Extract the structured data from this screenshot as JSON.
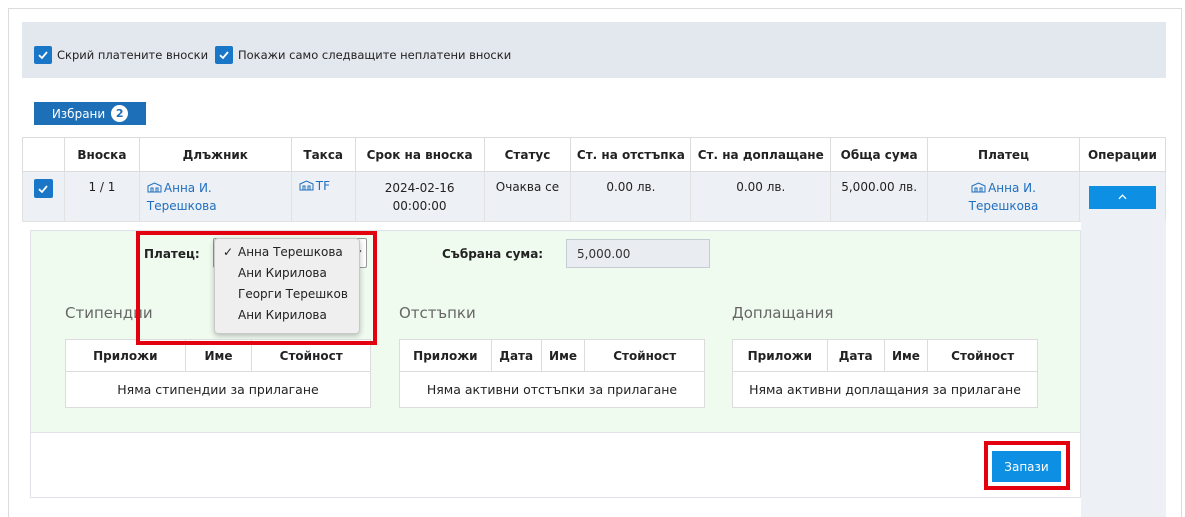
{
  "filters": {
    "hide_paid": "Скрий платените вноски",
    "show_next_unpaid": "Покажи само следващите неплатени вноски"
  },
  "selected_tab": {
    "label": "Избрани",
    "count": "2"
  },
  "table": {
    "headers": [
      "Вноска",
      "Длъжник",
      "Такса",
      "Срок на вноска",
      "Статус",
      "Ст. на отстъпка",
      "Ст. на доплащане",
      "Обща сума",
      "Платец",
      "Операции"
    ],
    "row": {
      "installment": "1 / 1",
      "debtor_line1": "Анна И.",
      "debtor_line2": "Терешкова",
      "fee": "TF",
      "due_date": "2024-02-16",
      "due_time": "00:00:00",
      "status": "Очаква се",
      "discount_value": "0.00 лв.",
      "surcharge_value": "0.00 лв.",
      "total": "5,000.00 лв.",
      "payer_line1": "Анна И.",
      "payer_line2": "Терешкова"
    }
  },
  "detail": {
    "payer_label": "Платец:",
    "payer_options": [
      "Анна Терешкова",
      "Ани Кирилова",
      "Георги Терешков",
      "Ани Кирилова"
    ],
    "collected_label": "Събрана сума:",
    "collected_value": "5,000.00",
    "scholarships": {
      "title": "Стипендии",
      "headers": [
        "Приложи",
        "Име",
        "Стойност"
      ],
      "empty": "Няма стипендии за прилагане"
    },
    "discounts": {
      "title": "Отстъпки",
      "headers": [
        "Приложи",
        "Дата",
        "Име",
        "Стойност"
      ],
      "empty": "Няма активни отстъпки за прилагане"
    },
    "surcharges": {
      "title": "Доплащания",
      "headers": [
        "Приложи",
        "Дата",
        "Име",
        "Стойност"
      ],
      "empty": "Няма активни доплащания за прилагане"
    },
    "save_label": "Запази"
  },
  "colors": {
    "primary": "#1a77c7",
    "button": "#0d8fe3",
    "highlight": "#e3000f"
  }
}
